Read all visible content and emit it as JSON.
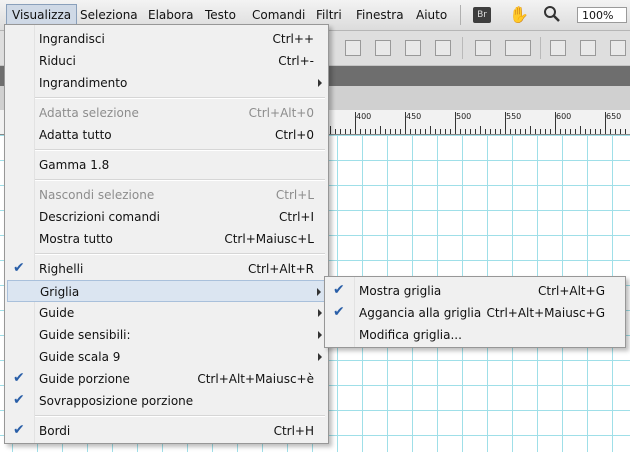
{
  "menubar": {
    "items": [
      "Visualizza",
      "Seleziona",
      "Elabora",
      "Testo",
      "Comandi",
      "Filtri",
      "Finestra",
      "Aiuto"
    ],
    "bridge_label": "Br",
    "hand_icon": "hand-icon",
    "zoom_icon": "magnifier-icon",
    "zoom_value": "100%"
  },
  "ruler": {
    "labels": [
      "400",
      "450",
      "500",
      "550",
      "600",
      "650"
    ]
  },
  "view_menu": {
    "items": [
      {
        "label": "Ingrandisci",
        "shortcut": "Ctrl++",
        "disabled": false,
        "checked": false,
        "submenu": false
      },
      {
        "label": "Riduci",
        "shortcut": "Ctrl+-",
        "disabled": false,
        "checked": false,
        "submenu": false
      },
      {
        "label": "Ingrandimento",
        "shortcut": "",
        "disabled": false,
        "checked": false,
        "submenu": true
      },
      {
        "label": "Adatta selezione",
        "shortcut": "Ctrl+Alt+0",
        "disabled": true,
        "checked": false,
        "submenu": false
      },
      {
        "label": "Adatta tutto",
        "shortcut": "Ctrl+0",
        "disabled": false,
        "checked": false,
        "submenu": false
      },
      {
        "label": "Gamma 1.8",
        "shortcut": "",
        "disabled": false,
        "checked": false,
        "submenu": false
      },
      {
        "label": "Nascondi selezione",
        "shortcut": "Ctrl+L",
        "disabled": true,
        "checked": false,
        "submenu": false
      },
      {
        "label": "Descrizioni comandi",
        "shortcut": "Ctrl+I",
        "disabled": false,
        "checked": false,
        "submenu": false
      },
      {
        "label": "Mostra tutto",
        "shortcut": "Ctrl+Maiusc+L",
        "disabled": false,
        "checked": false,
        "submenu": false
      },
      {
        "label": "Righelli",
        "shortcut": "Ctrl+Alt+R",
        "disabled": false,
        "checked": true,
        "submenu": false
      },
      {
        "label": "Griglia",
        "shortcut": "",
        "disabled": false,
        "checked": false,
        "submenu": true,
        "highlighted": true
      },
      {
        "label": "Guide",
        "shortcut": "",
        "disabled": false,
        "checked": false,
        "submenu": true
      },
      {
        "label": "Guide sensibili:",
        "shortcut": "",
        "disabled": false,
        "checked": false,
        "submenu": true
      },
      {
        "label": "Guide scala 9",
        "shortcut": "",
        "disabled": false,
        "checked": false,
        "submenu": true
      },
      {
        "label": "Guide porzione",
        "shortcut": "Ctrl+Alt+Maiusc+è",
        "disabled": false,
        "checked": true,
        "submenu": false
      },
      {
        "label": "Sovrapposizione porzione",
        "shortcut": "",
        "disabled": false,
        "checked": true,
        "submenu": false
      },
      {
        "label": "Bordi",
        "shortcut": "Ctrl+H",
        "disabled": false,
        "checked": true,
        "submenu": false
      }
    ]
  },
  "grid_submenu": {
    "items": [
      {
        "label": "Mostra griglia",
        "shortcut": "Ctrl+Alt+G",
        "checked": true
      },
      {
        "label": "Aggancia alla griglia",
        "shortcut": "Ctrl+Alt+Maiusc+G",
        "checked": true
      },
      {
        "label": "Modifica griglia...",
        "shortcut": "",
        "checked": false
      }
    ]
  },
  "colors": {
    "highlight": "#dbe5f1",
    "check": "#2a5fa8",
    "grid_line": "#9fdfe8"
  }
}
